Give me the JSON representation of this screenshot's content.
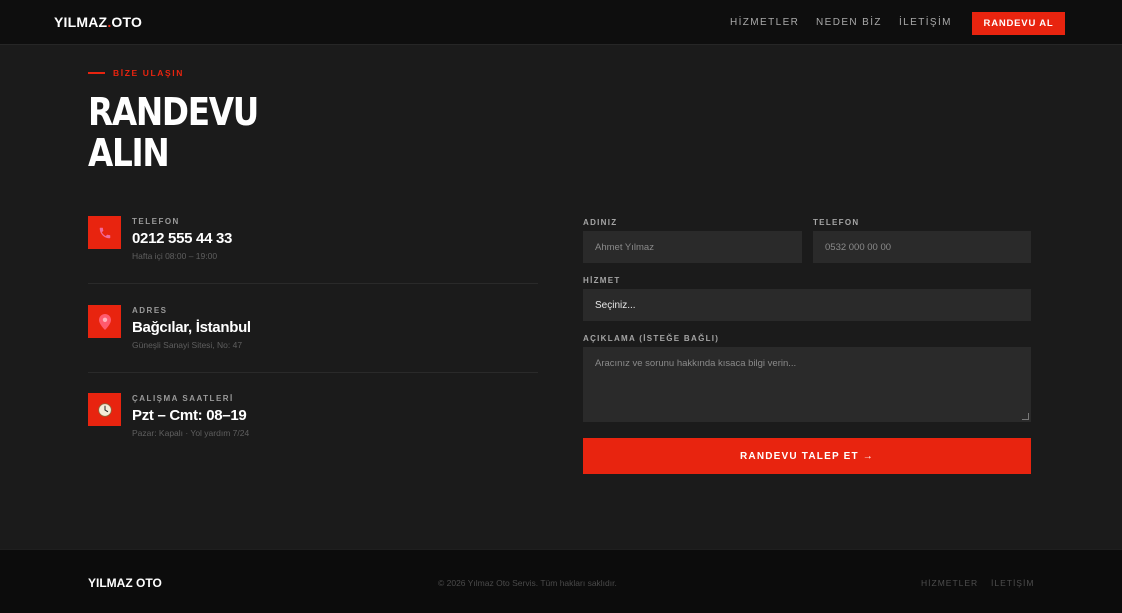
{
  "header": {
    "logo_main": "YILMAZ",
    "logo_dot": ".",
    "logo_rest": "OTO",
    "nav": [
      {
        "label": "HİZMETLER"
      },
      {
        "label": "NEDEN BİZ"
      },
      {
        "label": "İLETİŞİM"
      }
    ],
    "cta_label": "RANDEVU AL"
  },
  "section": {
    "eyebrow": "BİZE ULAŞIN",
    "title_line1": "RANDEVU",
    "title_line2": "ALIN"
  },
  "contact": [
    {
      "icon": "phone-icon",
      "label": "TELEFON",
      "value": "0212 555 44 33",
      "sub": "Hafta içi 08:00 – 19:00"
    },
    {
      "icon": "location-pin-icon",
      "label": "ADRES",
      "value": "Bağcılar, İstanbul",
      "sub": "Güneşli Sanayi Sitesi, No: 47"
    },
    {
      "icon": "clock-icon",
      "label": "ÇALIŞMA SAATLERİ",
      "value": "Pzt – Cmt: 08–19",
      "sub": "Pazar: Kapalı · Yol yardım 7/24"
    }
  ],
  "form": {
    "name_label": "ADINIZ",
    "name_placeholder": "Ahmet Yılmaz",
    "phone_label": "TELEFON",
    "phone_placeholder": "0532 000 00 00",
    "service_label": "HİZMET",
    "service_selected": "Seçiniz...",
    "description_label": "AÇIKLAMA (İSTEĞE BAĞLI)",
    "description_placeholder": "Aracınız ve sorunu hakkında kısaca bilgi verin...",
    "submit_label": "RANDEVU TALEP ET →"
  },
  "footer": {
    "logo": "YILMAZ OTO",
    "copyright": "© 2026 Yılmaz Oto Servis. Tüm hakları saklıdır.",
    "links": [
      {
        "label": "HİZMETLER"
      },
      {
        "label": "İLETİŞİM"
      }
    ]
  },
  "colors": {
    "accent": "#e8240f",
    "background": "#1b1b1b",
    "header_bg": "#0e0e0e",
    "field_bg": "#2a2a2a"
  }
}
